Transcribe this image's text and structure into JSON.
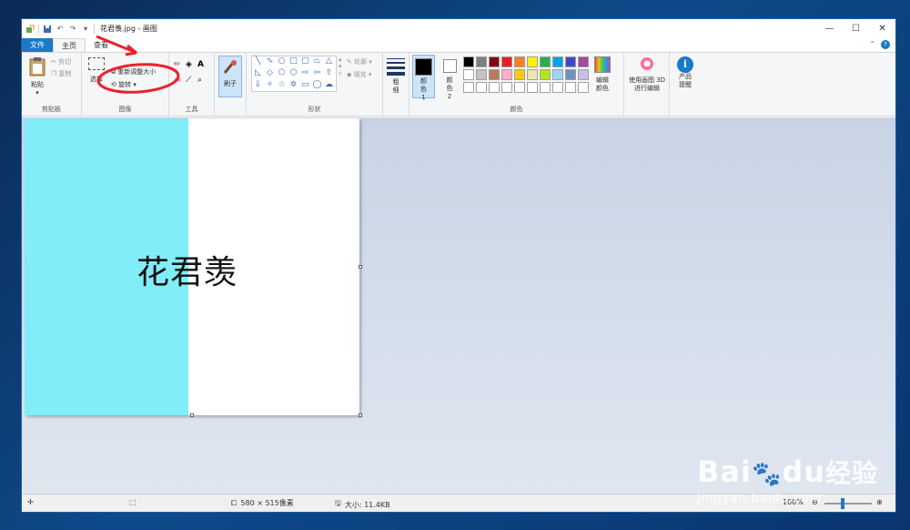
{
  "window": {
    "title": "花君羡.jpg - 画图",
    "controls": {
      "minimize": "—",
      "maximize": "☐",
      "close": "✕"
    }
  },
  "tabs": {
    "file": "文件",
    "home": "主页",
    "view": "查看"
  },
  "clipboard": {
    "paste": "粘贴",
    "cut": "剪切",
    "copy": "复制",
    "label": "剪贴板"
  },
  "image_group": {
    "select": "选择",
    "resize": "重新调整大小",
    "rotate": "旋转",
    "label": "图像"
  },
  "tools": {
    "label": "工具"
  },
  "brushes": {
    "label": "刷子"
  },
  "shapes": {
    "outline": "轮廓",
    "fill": "填充",
    "label": "形状"
  },
  "size": {
    "label": "粗细"
  },
  "colors_group": {
    "color1": "颜色 1",
    "color2": "颜色 2",
    "edit": "编辑颜色",
    "label": "颜色",
    "palette_row1": [
      "#000000",
      "#7f7f7f",
      "#880015",
      "#ed1c24",
      "#ff7f27",
      "#fff200",
      "#22b14c",
      "#00a2e8",
      "#3f48cc",
      "#a349a4"
    ],
    "palette_row2": [
      "#ffffff",
      "#c3c3c3",
      "#b97a57",
      "#ffaec9",
      "#ffc90e",
      "#efe4b0",
      "#b5e61d",
      "#99d9ea",
      "#7092be",
      "#c8bfe7"
    ]
  },
  "paint3d": {
    "label": "使用画图 3D 进行编辑"
  },
  "product": {
    "label": "产品提醒"
  },
  "canvas": {
    "text": "花君羡",
    "bg_left": "#80edf8",
    "bg_right": "#ffffff"
  },
  "status": {
    "dimensions": "580 × 515像素",
    "filesize": "大小: 11.4KB",
    "zoom": "100%"
  },
  "watermark": {
    "brand_a": "Bai",
    "brand_b": "du",
    "brand_c": "经验",
    "url": "jingyan.baidu.com"
  }
}
